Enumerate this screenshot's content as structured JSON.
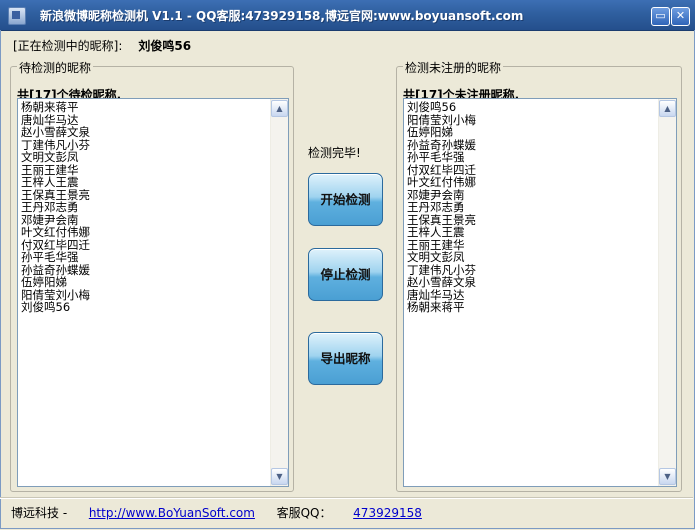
{
  "window": {
    "title": "新浪微博昵称检测机  V1.1 - QQ客服:473929158,博远官网:www.boyuansoft.com",
    "minimize_glyph": "▭",
    "close_glyph": "✕"
  },
  "checking": {
    "label": "[正在检测中的昵称]:",
    "value": "刘俊鸣56"
  },
  "pending": {
    "title": "待检测的昵称",
    "count_text": "共[17]个待检昵称.",
    "items": [
      "杨朝来蒋平",
      "唐灿华马达",
      "赵小雪薛文泉",
      "丁建伟凡小芬",
      "文明文彭凤",
      "王丽王建华",
      "王梓人王震",
      "王保真王景亮",
      "王丹邓志勇",
      "邓婕尹会南",
      "叶文红付伟娜",
      "付双红毕四迁",
      "孙平毛华强",
      "孙益奇孙蝶媛",
      "伍婷阳娣",
      "阳倩莹刘小梅",
      "刘俊鸣56"
    ]
  },
  "unregistered": {
    "title": "检测未注册的昵称",
    "count_text": "共[17]个未注册昵称.",
    "items": [
      "刘俊鸣56",
      "阳倩莹刘小梅",
      "伍婷阳娣",
      "孙益奇孙蝶媛",
      "孙平毛华强",
      "付双红毕四迁",
      "叶文红付伟娜",
      "邓婕尹会南",
      "王丹邓志勇",
      "王保真王景亮",
      "王梓人王震",
      "王丽王建华",
      "文明文彭凤",
      "丁建伟凡小芬",
      "赵小雪薛文泉",
      "唐灿华马达",
      "杨朝来蒋平"
    ]
  },
  "status_text": "检测完毕!",
  "buttons": {
    "start": "开始检测",
    "stop": "停止检测",
    "export": "导出昵称"
  },
  "footer": {
    "company": "博远科技 -",
    "website": "http://www.BoYuanSoft.com",
    "support_label": "客服QQ：",
    "support_qq": "473929158"
  },
  "icons": {
    "scroll_up": "▲",
    "scroll_down": "▼"
  }
}
